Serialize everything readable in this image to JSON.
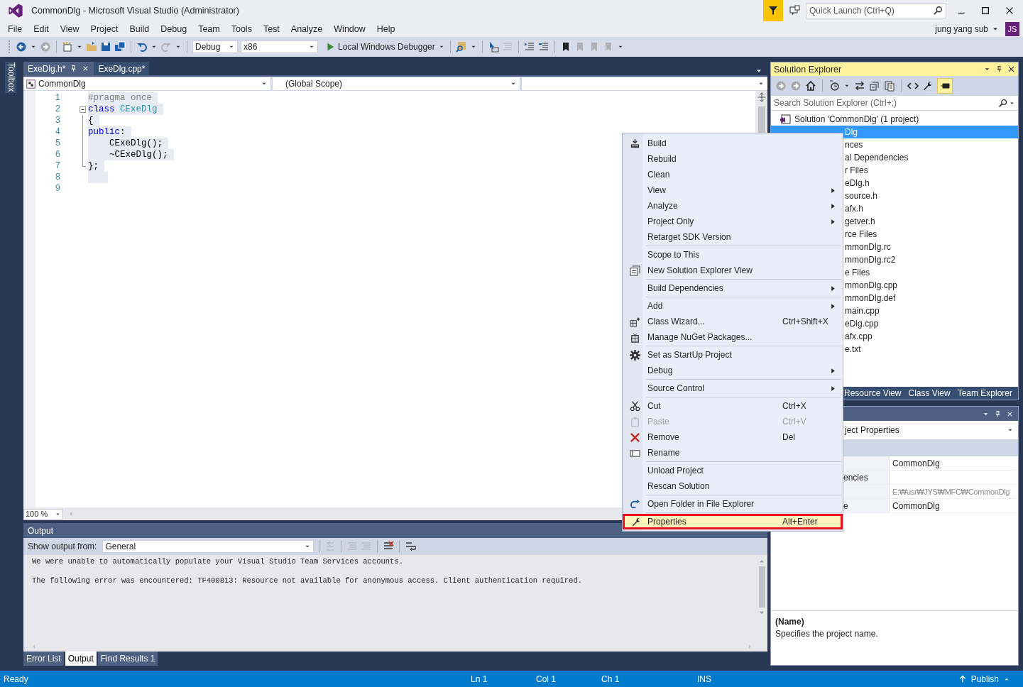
{
  "window": {
    "title": "CommonDlg - Microsoft Visual Studio (Administrator)",
    "quick_launch": {
      "placeholder": "Quick Launch (Ctrl+Q)"
    },
    "user": "jung yang sub",
    "avatar": "JS"
  },
  "menu": [
    "File",
    "Edit",
    "View",
    "Project",
    "Build",
    "Debug",
    "Team",
    "Tools",
    "Test",
    "Analyze",
    "Window",
    "Help"
  ],
  "toolbar": {
    "configuration": "Debug",
    "platform": "x86",
    "debugger": "Local Windows Debugger"
  },
  "toolbox_label": "Toolbox",
  "editor": {
    "tabs": [
      {
        "label": "ExeDlg.h*",
        "selected": true
      },
      {
        "label": "ExeDlg.cpp*",
        "selected": false
      }
    ],
    "project_dropdown": "CommonDlg",
    "scope_dropdown": "(Global Scope)",
    "lines": [
      {
        "number": "1",
        "selected": true,
        "collapsible": false,
        "outlined": false,
        "tokens": [
          {
            "kind": "directive",
            "text": "#pragma once"
          }
        ]
      },
      {
        "number": "2",
        "selected": true,
        "collapsible": true,
        "outlined": false,
        "tokens": [
          {
            "kind": "keyword",
            "text": "class "
          },
          {
            "kind": "type",
            "text": "CExeDlg"
          }
        ]
      },
      {
        "number": "3",
        "selected": true,
        "collapsible": false,
        "outlined": true,
        "tokens": [
          {
            "kind": "plain",
            "text": "{"
          }
        ]
      },
      {
        "number": "4",
        "selected": true,
        "collapsible": false,
        "outlined": true,
        "tokens": [
          {
            "kind": "keyword",
            "text": "public"
          },
          {
            "kind": "plain",
            "text": ":"
          }
        ]
      },
      {
        "number": "5",
        "selected": true,
        "collapsible": false,
        "outlined": true,
        "tokens": [
          {
            "kind": "plain",
            "text": "    CExeDlg();"
          }
        ]
      },
      {
        "number": "6",
        "selected": true,
        "collapsible": false,
        "outlined": true,
        "tokens": [
          {
            "kind": "plain",
            "text": "    ~CExeDlg();"
          }
        ]
      },
      {
        "number": "7",
        "selected": true,
        "collapsible": false,
        "outlined": true,
        "tokens": [
          {
            "kind": "plain",
            "text": "};"
          }
        ]
      },
      {
        "number": "8",
        "selected": true,
        "collapsible": false,
        "outlined": false
      },
      {
        "number": "9",
        "selected": false,
        "collapsible": false,
        "outlined": false
      }
    ],
    "zoom": "100 %"
  },
  "output": {
    "title": "Output",
    "show_from_label": "Show output from:",
    "source": "General",
    "messages": [
      "We were unable to automatically populate your Visual Studio Team Services accounts.",
      "The following error was encountered: TF400813: Resource not available for anonymous access. Client authentication required."
    ]
  },
  "bottom_tabs": [
    {
      "label": "Error List",
      "selected": false
    },
    {
      "label": "Output",
      "selected": true
    },
    {
      "label": "Find Results 1",
      "selected": false
    }
  ],
  "solution_explorer": {
    "title": "Solution Explorer",
    "search": {
      "placeholder": "Search Solution Explorer (Ctrl+;)"
    },
    "tree": [
      {
        "label": "Solution 'CommonDlg' (1 project)",
        "selected": false,
        "children": [
          {
            "label": "Dlg",
            "selected": true,
            "children": [
              {
                "label": "nces",
                "selected": false
              },
              {
                "label": "al Dependencies",
                "selected": false
              },
              {
                "label": "r Files",
                "selected": false,
                "children": [
                  {
                    "label": "eDlg.h",
                    "selected": false
                  },
                  {
                    "label": "source.h",
                    "selected": false
                  },
                  {
                    "label": "afx.h",
                    "selected": false
                  },
                  {
                    "label": "getver.h",
                    "selected": false
                  }
                ]
              },
              {
                "label": "rce Files",
                "selected": false,
                "children": [
                  {
                    "label": "mmonDlg.rc",
                    "selected": false
                  },
                  {
                    "label": "mmonDlg.rc2",
                    "selected": false
                  }
                ]
              },
              {
                "label": "e Files",
                "selected": false,
                "children": [
                  {
                    "label": "mmonDlg.cpp",
                    "selected": false
                  },
                  {
                    "label": "mmonDlg.def",
                    "selected": false
                  },
                  {
                    "label": "main.cpp",
                    "selected": false
                  },
                  {
                    "label": "eDlg.cpp",
                    "selected": false
                  },
                  {
                    "label": "afx.cpp",
                    "selected": false
                  }
                ]
              },
              {
                "label": "e.txt",
                "selected": false
              }
            ]
          }
        ]
      }
    ],
    "tabs": [
      "Resource View",
      "Class View",
      "Team Explorer"
    ]
  },
  "properties": {
    "object": "ject Properties",
    "rows": [
      {
        "value": "CommonDlg",
        "read_only": false
      },
      {
        "name": "encies"
      },
      {
        "value": "E:₩usr₩JYS₩MFC₩CommonDlg",
        "read_only": true
      },
      {
        "name": "e",
        "value": "CommonDlg",
        "read_only": false
      }
    ],
    "description_title": "(Name)",
    "description": "Specifies the project name."
  },
  "context_menu": {
    "groups": [
      [
        {
          "label": "Build",
          "submenu": false,
          "disabled": false,
          "selected": false
        },
        {
          "label": "Rebuild",
          "submenu": false,
          "disabled": false,
          "selected": false
        },
        {
          "label": "Clean",
          "submenu": false,
          "disabled": false,
          "selected": false
        },
        {
          "label": "View",
          "submenu": true,
          "disabled": false,
          "selected": false
        },
        {
          "label": "Analyze",
          "submenu": true,
          "disabled": false,
          "selected": false
        },
        {
          "label": "Project Only",
          "submenu": true,
          "disabled": false,
          "selected": false
        },
        {
          "label": "Retarget SDK Version",
          "submenu": false,
          "disabled": false,
          "selected": false
        }
      ],
      [
        {
          "label": "Scope to This",
          "submenu": false,
          "disabled": false,
          "selected": false
        },
        {
          "label": "New Solution Explorer View",
          "submenu": false,
          "disabled": false,
          "selected": false
        }
      ],
      [
        {
          "label": "Build Dependencies",
          "submenu": true,
          "disabled": false,
          "selected": false
        }
      ],
      [
        {
          "label": "Add",
          "submenu": true,
          "disabled": false,
          "selected": false
        },
        {
          "label": "Class Wizard...",
          "shortcut": "Ctrl+Shift+X",
          "submenu": false,
          "disabled": false,
          "selected": false
        },
        {
          "label": "Manage NuGet Packages...",
          "submenu": false,
          "disabled": false,
          "selected": false
        }
      ],
      [
        {
          "label": "Set as StartUp Project",
          "submenu": false,
          "disabled": false,
          "selected": false
        },
        {
          "label": "Debug",
          "submenu": true,
          "disabled": false,
          "selected": false
        }
      ],
      [
        {
          "label": "Source Control",
          "submenu": true,
          "disabled": false,
          "selected": false
        }
      ],
      [
        {
          "label": "Cut",
          "shortcut": "Ctrl+X",
          "submenu": false,
          "disabled": false,
          "selected": false
        },
        {
          "label": "Paste",
          "shortcut": "Ctrl+V",
          "submenu": false,
          "disabled": true,
          "selected": false
        },
        {
          "label": "Remove",
          "shortcut": "Del",
          "submenu": false,
          "disabled": false,
          "selected": false
        },
        {
          "label": "Rename",
          "submenu": false,
          "disabled": false,
          "selected": false
        }
      ],
      [
        {
          "label": "Unload Project",
          "submenu": false,
          "disabled": false,
          "selected": false
        },
        {
          "label": "Rescan Solution",
          "submenu": false,
          "disabled": false,
          "selected": false
        }
      ],
      [
        {
          "label": "Open Folder in File Explorer",
          "submenu": false,
          "disabled": false,
          "selected": false
        }
      ],
      [
        {
          "label": "Properties",
          "shortcut": "Alt+Enter",
          "submenu": false,
          "disabled": false,
          "selected": true
        }
      ]
    ]
  },
  "status_bar": {
    "state": "Ready",
    "line": "Ln 1",
    "column": "Col 1",
    "char": "Ch 1",
    "mode": "INS",
    "publish": "Publish"
  }
}
